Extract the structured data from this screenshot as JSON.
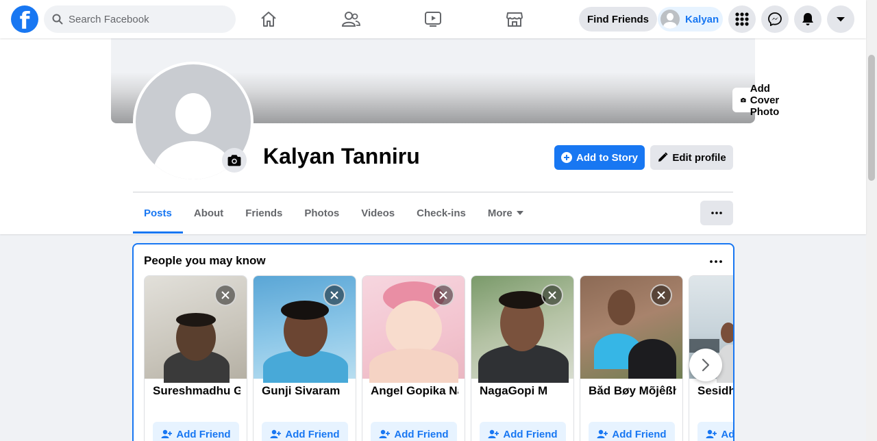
{
  "topbar": {
    "logo_letter": "f",
    "search_placeholder": "Search Facebook",
    "nav_icons": [
      "home-icon",
      "friends-icon",
      "watch-icon",
      "marketplace-icon"
    ],
    "find_friends_label": "Find Friends",
    "me_name": "Kalyan",
    "right_icons": [
      "menu-grid-icon",
      "messenger-icon",
      "notifications-icon",
      "account-caret-icon"
    ]
  },
  "profile": {
    "name": "Kalyan Tanniru",
    "add_cover_label": "Add Cover Photo",
    "add_story_label": "Add to Story",
    "edit_profile_label": "Edit profile"
  },
  "tabs": [
    {
      "label": "Posts",
      "active": true
    },
    {
      "label": "About"
    },
    {
      "label": "Friends"
    },
    {
      "label": "Photos"
    },
    {
      "label": "Videos"
    },
    {
      "label": "Check-ins"
    },
    {
      "label": "More"
    }
  ],
  "pymk": {
    "title": "People you may know",
    "add_friend_label": "Add Friend",
    "people": [
      {
        "name": "Sureshmadhu Gu"
      },
      {
        "name": "Gunji Sivaram"
      },
      {
        "name": "Angel Gopika Na"
      },
      {
        "name": "NagaGopi M"
      },
      {
        "name": "Bǎd Bøy Mõjêßh"
      },
      {
        "name": "Sesidhar"
      }
    ]
  },
  "colors": {
    "brand": "#1877f2",
    "page_bg": "#f0f2f5",
    "button_gray": "#e4e6eb",
    "light_blue": "#e7f3ff"
  }
}
